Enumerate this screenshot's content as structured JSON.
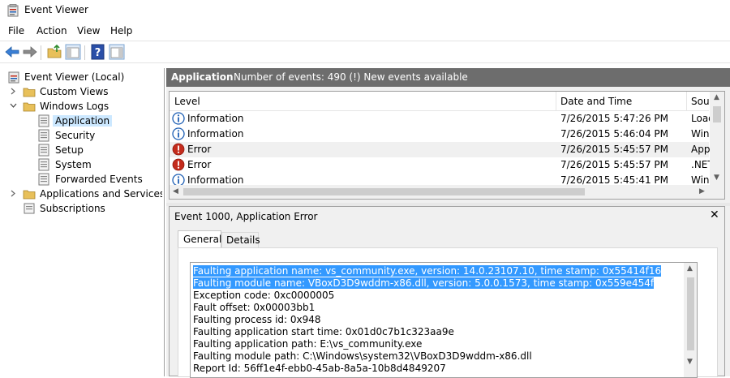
{
  "window": {
    "title": "Event Viewer"
  },
  "menu": {
    "file": "File",
    "action": "Action",
    "view": "View",
    "help": "Help"
  },
  "tree": {
    "root": "Event Viewer (Local)",
    "custom_views": "Custom Views",
    "windows_logs": "Windows Logs",
    "application": "Application",
    "security": "Security",
    "setup": "Setup",
    "system": "System",
    "forwarded_events": "Forwarded Events",
    "apps_services": "Applications and Services Lo",
    "subscriptions": "Subscriptions"
  },
  "list_header": {
    "title": "Application",
    "count": "Number of events: 490 (!) New events available"
  },
  "columns": {
    "level": "Level",
    "datetime": "Date and Time",
    "source": "Sour"
  },
  "events": [
    {
      "level": "Information",
      "datetime": "7/26/2015 5:47:26 PM",
      "source": "Load",
      "icon": "information-icon"
    },
    {
      "level": "Information",
      "datetime": "7/26/2015 5:46:04 PM",
      "source": "Winc",
      "icon": "information-icon"
    },
    {
      "level": "Error",
      "datetime": "7/26/2015 5:45:57 PM",
      "source": "Appl",
      "icon": "error-icon"
    },
    {
      "level": "Error",
      "datetime": "7/26/2015 5:45:57 PM",
      "source": ".NET",
      "icon": "error-icon"
    },
    {
      "level": "Information",
      "datetime": "7/26/2015 5:45:41 PM",
      "source": "Winc",
      "icon": "information-icon"
    }
  ],
  "detail": {
    "title": "Event 1000, Application Error",
    "close": "✕",
    "tab_general": "General",
    "tab_details": "Details",
    "lines": [
      "Faulting application name: vs_community.exe, version: 14.0.23107.10, time stamp: 0x55414f16",
      "Faulting module name: VBoxD3D9wddm-x86.dll, version: 5.0.0.1573, time stamp: 0x559e454f",
      "Exception code: 0xc0000005",
      "Fault offset: 0x00003bb1",
      "Faulting process id: 0x948",
      "Faulting application start time: 0x01d0c7b1c323aa9e",
      "Faulting application path: E:\\vs_community.exe",
      "Faulting module path: C:\\Windows\\system32\\VBoxD3D9wddm-x86.dll",
      "Report Id: 56ff1e4f-ebb0-45ab-8a5a-10b8d4849207"
    ]
  },
  "colors": {
    "header_bg": "#6d6d6d",
    "selection": "#3399ff",
    "tree_selected": "#cce8ff",
    "error_red": "#c42b1c",
    "info_blue": "#1e5fb4"
  }
}
